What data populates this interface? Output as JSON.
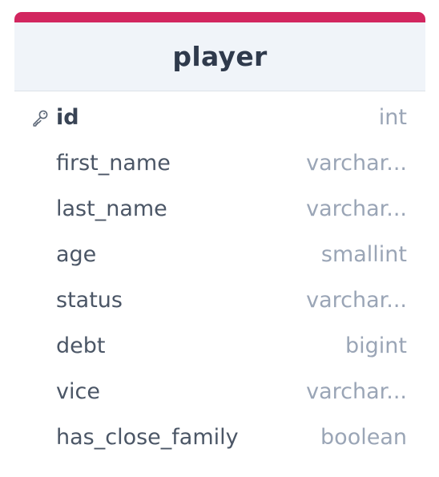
{
  "table": {
    "name": "player",
    "accent_color": "#d2265f",
    "columns": [
      {
        "name": "id",
        "type": "int",
        "primary_key": true,
        "icon": "key-icon"
      },
      {
        "name": "first_name",
        "type": "varchar..."
      },
      {
        "name": "last_name",
        "type": "varchar..."
      },
      {
        "name": "age",
        "type": "smallint"
      },
      {
        "name": "status",
        "type": "varchar..."
      },
      {
        "name": "debt",
        "type": "bigint"
      },
      {
        "name": "vice",
        "type": "varchar..."
      },
      {
        "name": "has_close_family",
        "type": "boolean"
      }
    ]
  }
}
